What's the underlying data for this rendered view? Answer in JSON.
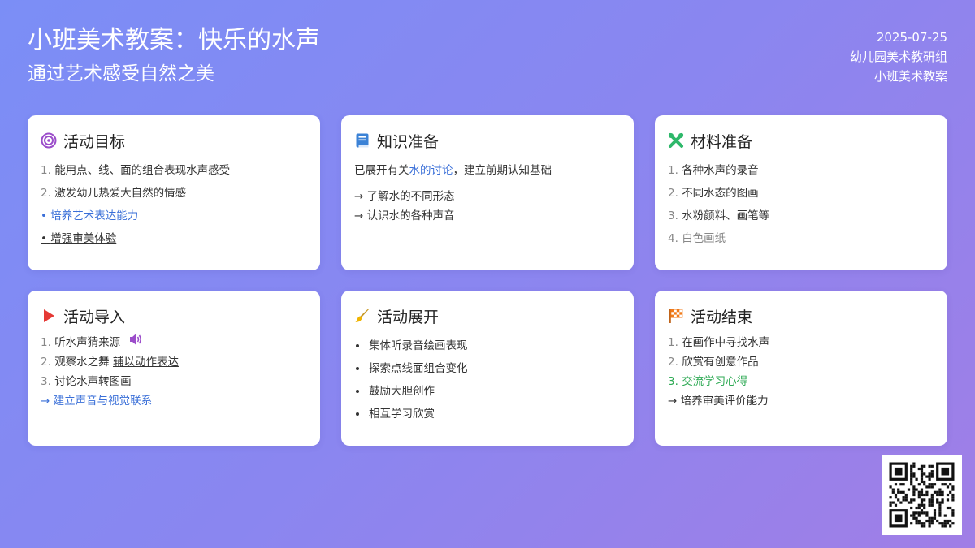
{
  "header": {
    "title": "小班美术教案：快乐的水声",
    "subtitle": "通过艺术感受自然之美",
    "date": "2025-07-25",
    "author": "幼儿园美术教研组",
    "doc_type": "小班美术教案"
  },
  "cards": {
    "goals": {
      "title": "活动目标",
      "items": [
        "能用点、线、面的组合表现水声感受",
        "激发幼儿热爱大自然的情感",
        "培养艺术表达能力",
        "增强审美体验"
      ],
      "nums": [
        "1.",
        "2."
      ],
      "bullet": "•"
    },
    "knowledge": {
      "title": "知识准备",
      "intro_pre": "已展开有关",
      "intro_link": "水的讨论",
      "intro_post": "，建立前期认知基础",
      "items": [
        "→ 了解水的不同形态",
        "→ 认识水的各种声音"
      ]
    },
    "materials": {
      "title": "材料准备",
      "nums": [
        "1.",
        "2.",
        "3.",
        "4."
      ],
      "items": [
        "各种水声的录音",
        "不同水态的图画",
        "水粉颜料、画笔等",
        "白色画纸"
      ]
    },
    "intro": {
      "title": "活动导入",
      "nums": [
        "1.",
        "2.",
        "3."
      ],
      "item1": "听水声猜来源",
      "item2_pre": "观察水之舞",
      "item2_link": "辅以动作表达",
      "item3": "讨论水声转图画",
      "item4": "→ 建立声音与视觉联系"
    },
    "develop": {
      "title": "活动展开",
      "items": [
        "集体听录音绘画表现",
        "探索点线面组合变化",
        "鼓励大胆创作",
        "相互学习欣赏"
      ]
    },
    "ending": {
      "title": "活动结束",
      "nums": [
        "1.",
        "2.",
        "3."
      ],
      "items": [
        "在画作中寻找水声",
        "欣赏有创意作品",
        "交流学习心得"
      ],
      "item4": "→ 培养审美评价能力"
    }
  },
  "colors": {
    "accent_blue": "#3a6fd8",
    "accent_green": "#2faa55",
    "target_icon": "#9b4dca",
    "book_icon": "#3b82d6",
    "tools_icon": "#2eb86a",
    "play_icon": "#e53935",
    "brush_icon": "#f0b400",
    "flag_icon": "#f07a1a"
  },
  "icons": [
    "target-icon",
    "book-icon",
    "tools-icon",
    "play-icon",
    "speaker-icon",
    "brush-icon",
    "checkered-flag-icon",
    "qr-code"
  ]
}
